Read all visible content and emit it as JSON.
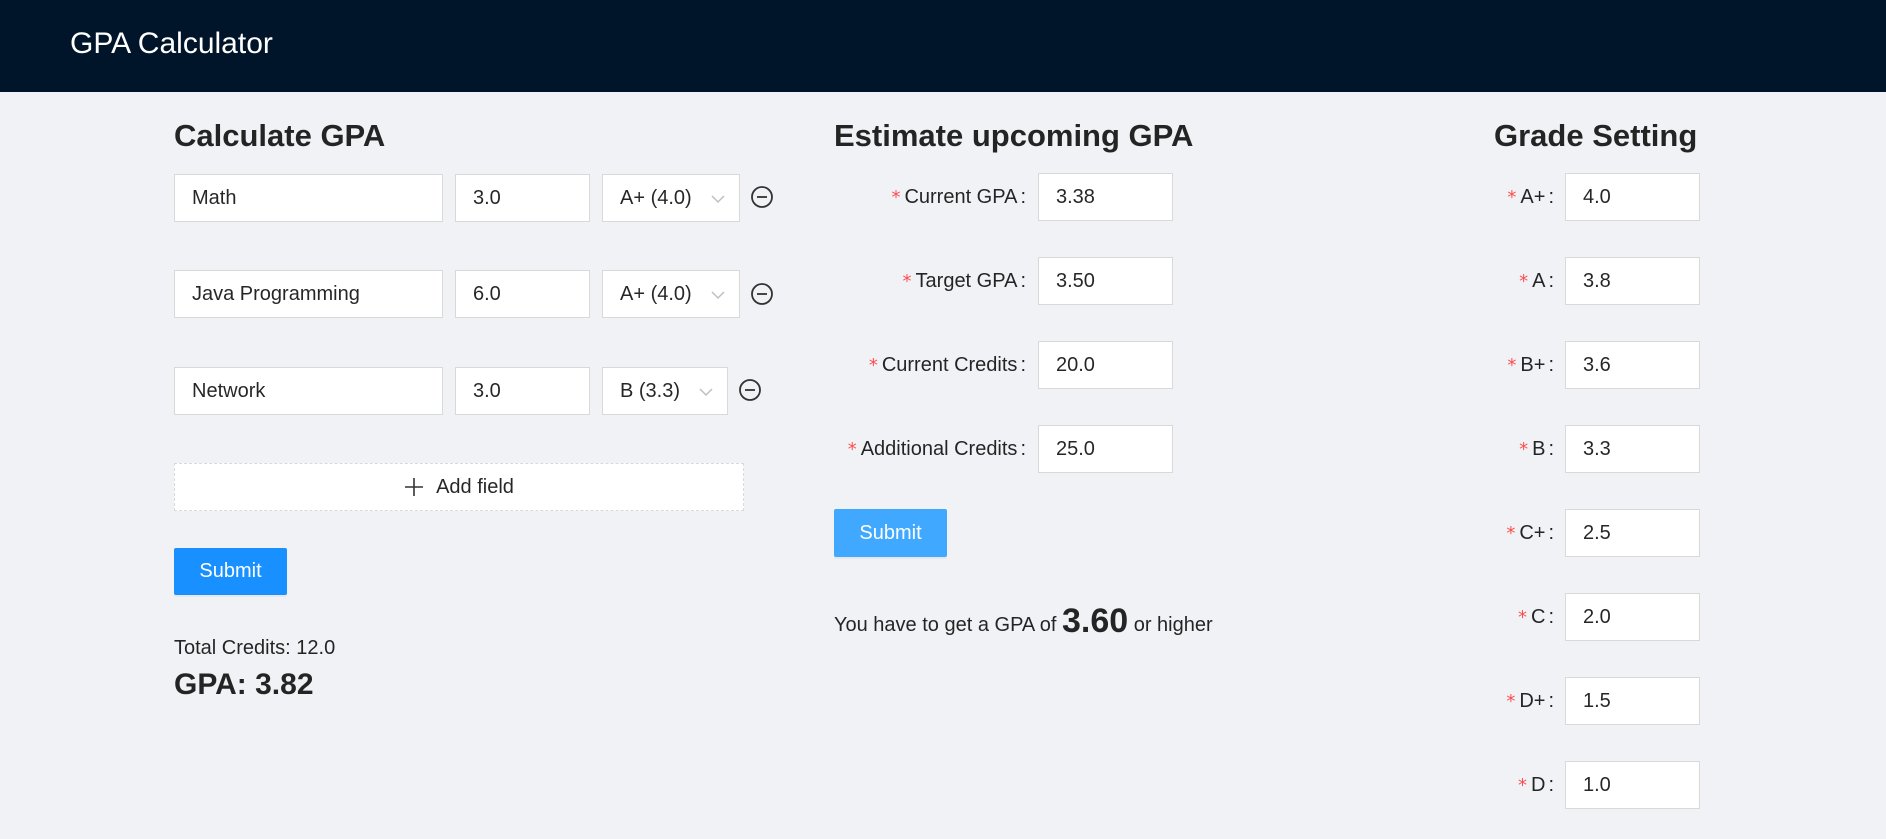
{
  "app": {
    "title": "GPA Calculator"
  },
  "calculate": {
    "heading": "Calculate GPA",
    "courses": [
      {
        "name": "Math",
        "credits": "3.0",
        "grade": "A+ (4.0)"
      },
      {
        "name": "Java Programming",
        "credits": "6.0",
        "grade": "A+ (4.0)"
      },
      {
        "name": "Network",
        "credits": "3.0",
        "grade": "B (3.3)"
      }
    ],
    "add_field_label": "Add field",
    "submit_label": "Submit",
    "total_credits_text": "Total Credits: 12.0",
    "gpa_text": "GPA: 3.82"
  },
  "estimate": {
    "heading": "Estimate upcoming GPA",
    "fields": [
      {
        "label": "Current GPA",
        "value": "3.38"
      },
      {
        "label": "Target GPA",
        "value": "3.50"
      },
      {
        "label": "Current Credits",
        "value": "20.0"
      },
      {
        "label": "Additional Credits",
        "value": "25.0"
      }
    ],
    "submit_label": "Submit",
    "result_prefix": "You have to get a GPA of",
    "result_value": "3.60",
    "result_suffix": "or higher"
  },
  "grades": {
    "heading": "Grade Setting",
    "items": [
      {
        "label": "A+",
        "value": "4.0"
      },
      {
        "label": "A",
        "value": "3.8"
      },
      {
        "label": "B+",
        "value": "3.6"
      },
      {
        "label": "B",
        "value": "3.3"
      },
      {
        "label": "C+",
        "value": "2.5"
      },
      {
        "label": "C",
        "value": "2.0"
      },
      {
        "label": "D+",
        "value": "1.5"
      },
      {
        "label": "D",
        "value": "1.0"
      }
    ]
  },
  "icons": {
    "remove": "minus-circle-icon",
    "add": "plus-icon",
    "select": "chevron-down-icon"
  },
  "colors": {
    "header_bg": "#001529",
    "page_bg": "#f0f2f5",
    "primary": "#1890ff",
    "required": "#ff4d4f"
  }
}
